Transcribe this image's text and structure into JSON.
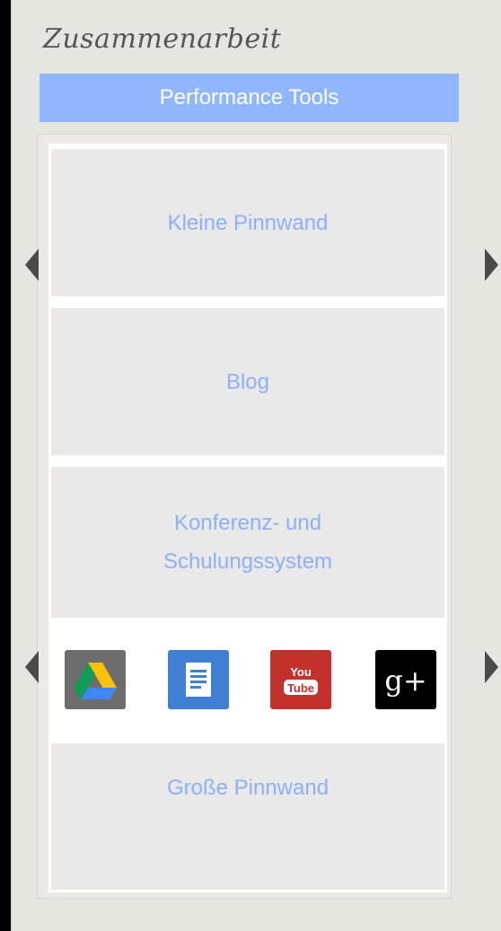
{
  "panel": {
    "title": "Zusammenarbeit",
    "tab_label": "Performance Tools"
  },
  "tiles": [
    {
      "label": "Kleine Pinnwand"
    },
    {
      "label": "Blog"
    },
    {
      "label": "Konferenz- und Schulungssystem"
    },
    {
      "label": "Große Pinnwand"
    }
  ],
  "icons": [
    {
      "name": "google-drive-icon"
    },
    {
      "name": "google-docs-icon"
    },
    {
      "name": "youtube-icon",
      "text_top": "You",
      "text_bottom": "Tube"
    },
    {
      "name": "google-plus-icon",
      "text": "g+"
    }
  ],
  "colors": {
    "tab_background": "#90b6ff",
    "tile_text": "#8db0f7",
    "panel_background": "#e6e6e1"
  }
}
